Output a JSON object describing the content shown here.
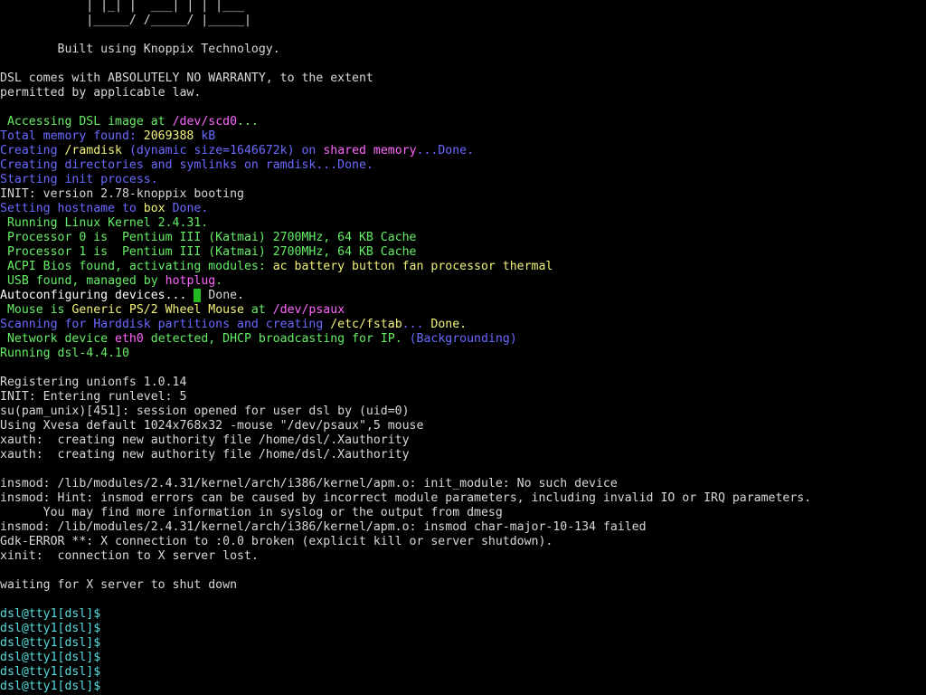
{
  "screen": {
    "background": "#000000",
    "font": "monospace console",
    "colors": {
      "default": "#d8d8d8",
      "green": "#66ee66",
      "blue": "#6a6aff",
      "yellow": "#f2f27a",
      "magenta": "#ff66ff",
      "cyan": "#55dddd",
      "white": "#ffffff",
      "cursor": "#22bb22"
    }
  },
  "console": {
    "lines": [
      {
        "row": 0,
        "segments": [
          {
            "text": "            | |_| |  ___| | | |___",
            "color": "#d8d8d8"
          }
        ]
      },
      {
        "row": 1,
        "segments": [
          {
            "text": "            |_____/ /_____/ |_____|",
            "color": "#d8d8d8"
          }
        ]
      },
      {
        "row": 3,
        "segments": [
          {
            "text": "        Built using Knoppix Technology.",
            "color": "#d8d8d8"
          }
        ]
      },
      {
        "row": 5,
        "segments": [
          {
            "text": "DSL comes with ABSOLUTELY NO WARRANTY, to the extent",
            "color": "#d8d8d8"
          }
        ]
      },
      {
        "row": 6,
        "segments": [
          {
            "text": "permitted by applicable law.",
            "color": "#d8d8d8"
          }
        ]
      },
      {
        "row": 8,
        "segments": [
          {
            "text": " Accessing DSL image at ",
            "color": "#66ee66"
          },
          {
            "text": "/dev/scd0",
            "color": "#ff66ff"
          },
          {
            "text": "...",
            "color": "#66ee66"
          }
        ]
      },
      {
        "row": 9,
        "segments": [
          {
            "text": "Total memory found: ",
            "color": "#6a6aff"
          },
          {
            "text": "2069388",
            "color": "#f2f27a"
          },
          {
            "text": " kB",
            "color": "#6a6aff"
          }
        ]
      },
      {
        "row": 10,
        "segments": [
          {
            "text": "Creating ",
            "color": "#6a6aff"
          },
          {
            "text": "/ramdisk",
            "color": "#f2f27a"
          },
          {
            "text": " (dynamic size=1646672k) on ",
            "color": "#6a6aff"
          },
          {
            "text": "shared memory",
            "color": "#ff66ff"
          },
          {
            "text": "...Done.",
            "color": "#6a6aff"
          }
        ]
      },
      {
        "row": 11,
        "segments": [
          {
            "text": "Creating directories and symlinks on ramdisk...Done.",
            "color": "#6a6aff"
          }
        ]
      },
      {
        "row": 12,
        "segments": [
          {
            "text": "Starting init process.",
            "color": "#6a6aff"
          }
        ]
      },
      {
        "row": 13,
        "segments": [
          {
            "text": "INIT: version 2.78-knoppix booting",
            "color": "#d8d8d8"
          }
        ]
      },
      {
        "row": 14,
        "segments": [
          {
            "text": "Setting hostname to ",
            "color": "#6a6aff"
          },
          {
            "text": "box",
            "color": "#f2f27a"
          },
          {
            "text": " Done.",
            "color": "#6a6aff"
          }
        ]
      },
      {
        "row": 15,
        "segments": [
          {
            "text": " Running Linux Kernel 2.4.31.",
            "color": "#66ee66"
          }
        ]
      },
      {
        "row": 16,
        "segments": [
          {
            "text": " Processor 0 is  Pentium III (Katmai) 2700MHz, 64 KB Cache",
            "color": "#66ee66"
          }
        ]
      },
      {
        "row": 17,
        "segments": [
          {
            "text": " Processor 1 is  Pentium III (Katmai) 2700MHz, 64 KB Cache",
            "color": "#66ee66"
          }
        ]
      },
      {
        "row": 18,
        "segments": [
          {
            "text": " ACPI Bios found, activating modules: ",
            "color": "#66ee66"
          },
          {
            "text": "ac battery button fan processor thermal",
            "color": "#f2f27a"
          }
        ]
      },
      {
        "row": 19,
        "segments": [
          {
            "text": " USB found, managed by ",
            "color": "#66ee66"
          },
          {
            "text": "hotplug",
            "color": "#ff66ff"
          },
          {
            "text": ".",
            "color": "#66ee66"
          }
        ]
      },
      {
        "row": 20,
        "segments": [
          {
            "text": "Autoconfiguring devices... ",
            "color": "#ffffff"
          },
          {
            "text": "CURSOR",
            "color": "#22bb22"
          },
          {
            "text": " Done.",
            "color": "#d8d8d8"
          }
        ]
      },
      {
        "row": 21,
        "segments": [
          {
            "text": " Mouse is ",
            "color": "#66ee66"
          },
          {
            "text": "Generic PS/2 Wheel Mouse",
            "color": "#f2f27a"
          },
          {
            "text": " at ",
            "color": "#66ee66"
          },
          {
            "text": "/dev/psaux",
            "color": "#ff66ff"
          }
        ]
      },
      {
        "row": 22,
        "segments": [
          {
            "text": "Scanning for Harddisk partitions and creating ",
            "color": "#6a6aff"
          },
          {
            "text": "/etc/fstab",
            "color": "#f2f27a"
          },
          {
            "text": "... ",
            "color": "#6a6aff"
          },
          {
            "text": "Done.",
            "color": "#f2f27a"
          }
        ]
      },
      {
        "row": 23,
        "segments": [
          {
            "text": " Network device ",
            "color": "#66ee66"
          },
          {
            "text": "eth0",
            "color": "#ff66ff"
          },
          {
            "text": " detected, DHCP broadcasting for IP. ",
            "color": "#66ee66"
          },
          {
            "text": "(Backgrounding)",
            "color": "#6a6aff"
          }
        ]
      },
      {
        "row": 24,
        "segments": [
          {
            "text": "Running dsl-4.4.10",
            "color": "#66ee66"
          }
        ]
      },
      {
        "row": 26,
        "segments": [
          {
            "text": "Registering unionfs 1.0.14",
            "color": "#d8d8d8"
          }
        ]
      },
      {
        "row": 27,
        "segments": [
          {
            "text": "INIT: Entering runlevel: 5",
            "color": "#d8d8d8"
          }
        ]
      },
      {
        "row": 28,
        "segments": [
          {
            "text": "su(pam_unix)[451]: session opened for user dsl by (uid=0)",
            "color": "#d8d8d8"
          }
        ]
      },
      {
        "row": 29,
        "segments": [
          {
            "text": "Using Xvesa default 1024x768x32 -mouse \"/dev/psaux\",5 mouse",
            "color": "#d8d8d8"
          }
        ]
      },
      {
        "row": 30,
        "segments": [
          {
            "text": "xauth:  creating new authority file /home/dsl/.Xauthority",
            "color": "#d8d8d8"
          }
        ]
      },
      {
        "row": 31,
        "segments": [
          {
            "text": "xauth:  creating new authority file /home/dsl/.Xauthority",
            "color": "#d8d8d8"
          }
        ]
      },
      {
        "row": 33,
        "segments": [
          {
            "text": "insmod: /lib/modules/2.4.31/kernel/arch/i386/kernel/apm.o: init_module: No such device",
            "color": "#d8d8d8"
          }
        ]
      },
      {
        "row": 34,
        "segments": [
          {
            "text": "insmod: Hint: insmod errors can be caused by incorrect module parameters, including invalid IO or IRQ parameters.",
            "color": "#d8d8d8"
          }
        ]
      },
      {
        "row": 35,
        "segments": [
          {
            "text": "      You may find more information in syslog or the output from dmesg",
            "color": "#d8d8d8"
          }
        ]
      },
      {
        "row": 36,
        "segments": [
          {
            "text": "insmod: /lib/modules/2.4.31/kernel/arch/i386/kernel/apm.o: insmod char-major-10-134 failed",
            "color": "#d8d8d8"
          }
        ]
      },
      {
        "row": 37,
        "segments": [
          {
            "text": "Gdk-ERROR **: X connection to :0.0 broken (explicit kill or server shutdown).",
            "color": "#d8d8d8"
          }
        ]
      },
      {
        "row": 38,
        "segments": [
          {
            "text": "xinit:  connection to X server lost.",
            "color": "#d8d8d8"
          }
        ]
      },
      {
        "row": 40,
        "segments": [
          {
            "text": "waiting for X server to shut down",
            "color": "#d8d8d8"
          }
        ]
      },
      {
        "row": 42,
        "segments": [
          {
            "text": "dsl@tty1[dsl]$",
            "color": "#55dddd"
          }
        ]
      },
      {
        "row": 43,
        "segments": [
          {
            "text": "dsl@tty1[dsl]$",
            "color": "#55dddd"
          }
        ]
      },
      {
        "row": 44,
        "segments": [
          {
            "text": "dsl@tty1[dsl]$",
            "color": "#55dddd"
          }
        ]
      },
      {
        "row": 45,
        "segments": [
          {
            "text": "dsl@tty1[dsl]$",
            "color": "#55dddd"
          }
        ]
      },
      {
        "row": 46,
        "segments": [
          {
            "text": "dsl@tty1[dsl]$",
            "color": "#55dddd"
          }
        ]
      },
      {
        "row": 47,
        "segments": [
          {
            "text": "dsl@tty1[dsl]$",
            "color": "#55dddd"
          }
        ]
      }
    ]
  }
}
